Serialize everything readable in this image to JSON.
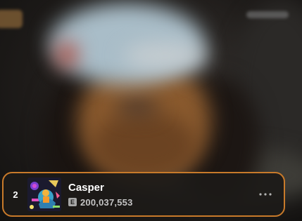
{
  "track": {
    "rank": "2",
    "title": "Casper",
    "explicit_label": "E",
    "play_count": "200,037,553",
    "more_icon": "more-horizontal-icon"
  },
  "colors": {
    "card_border": "#c87a2a",
    "card_background": "#1c1a18",
    "text_primary": "#ffffff",
    "text_secondary": "#c4c4c4"
  }
}
